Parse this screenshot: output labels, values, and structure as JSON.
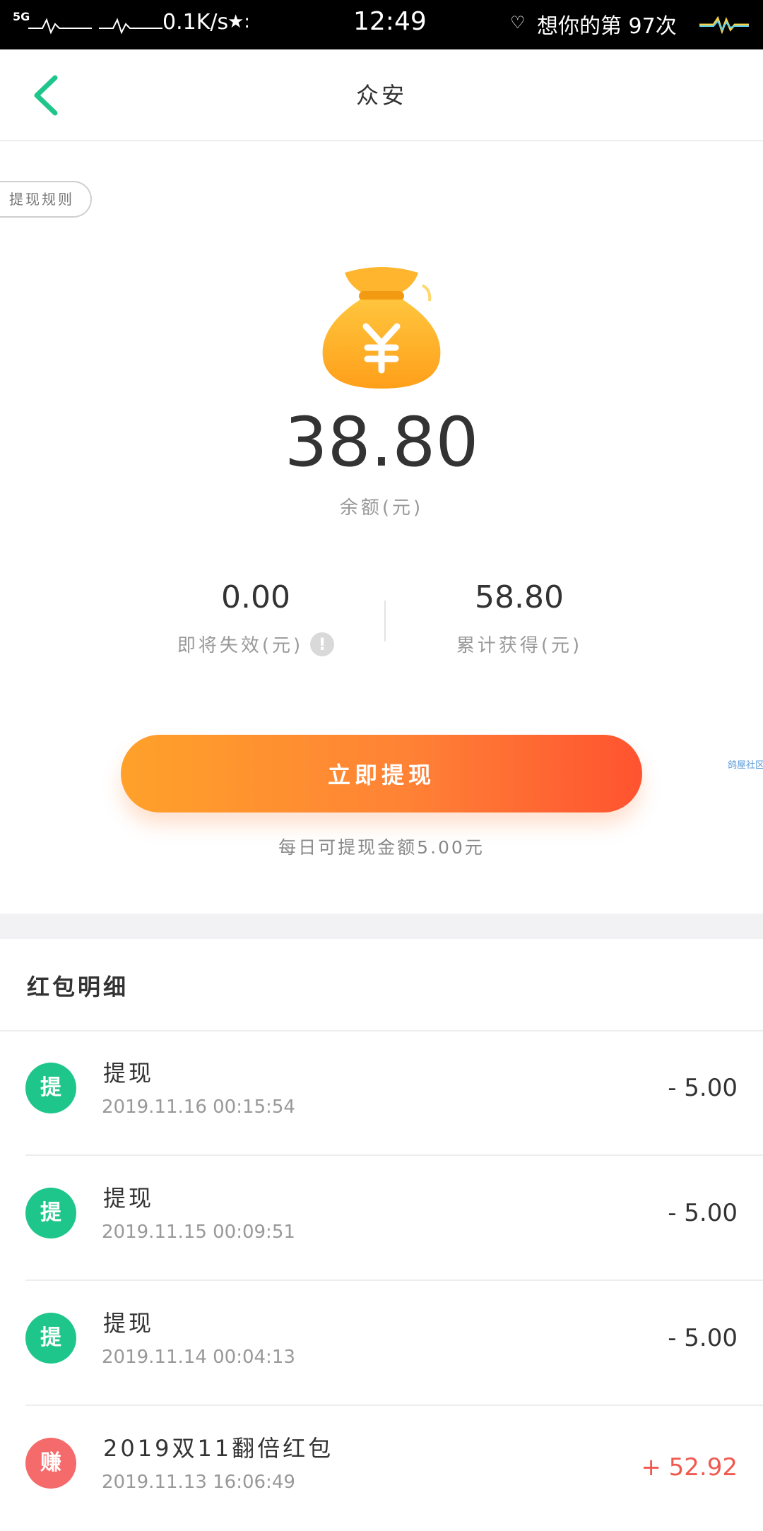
{
  "status_bar": {
    "signal": "5G",
    "speed": "0.1K/s",
    "time": "12:49",
    "message": "想你的第 97次"
  },
  "header": {
    "title": "众安"
  },
  "rules_button": "提现规则",
  "balance": {
    "amount": "38.80",
    "label": "余额(元)"
  },
  "stats": {
    "expiring": {
      "value": "0.00",
      "label": "即将失效(元)",
      "icon": "info-icon"
    },
    "total": {
      "value": "58.80",
      "label": "累计获得(元)"
    }
  },
  "withdraw_button": "立即提现",
  "side_text": "鸽屋社区",
  "daily_limit": "每日可提现金额5.00元",
  "section_title": "红包明细",
  "records": [
    {
      "badge": "提",
      "badge_color": "#1fc68c",
      "title": "提现",
      "date": "2019.11.16 00:15:54",
      "amount": "- 5.00"
    },
    {
      "badge": "提",
      "badge_color": "#1fc68c",
      "title": "提现",
      "date": "2019.11.15 00:09:51",
      "amount": "- 5.00"
    },
    {
      "badge": "提",
      "badge_color": "#1fc68c",
      "title": "提现",
      "date": "2019.11.14 00:04:13",
      "amount": "- 5.00"
    },
    {
      "badge": "赚",
      "badge_color": "#f56a6a",
      "title": "2019双11翻倍红包",
      "date": "2019.11.13 16:06:49",
      "amount": "+ 52.92"
    }
  ],
  "colors": {
    "accent_green": "#1fc68c",
    "button_gradient_start": "#ffa12a",
    "button_gradient_end": "#ff5330",
    "plus_amount": "#f0594f"
  }
}
